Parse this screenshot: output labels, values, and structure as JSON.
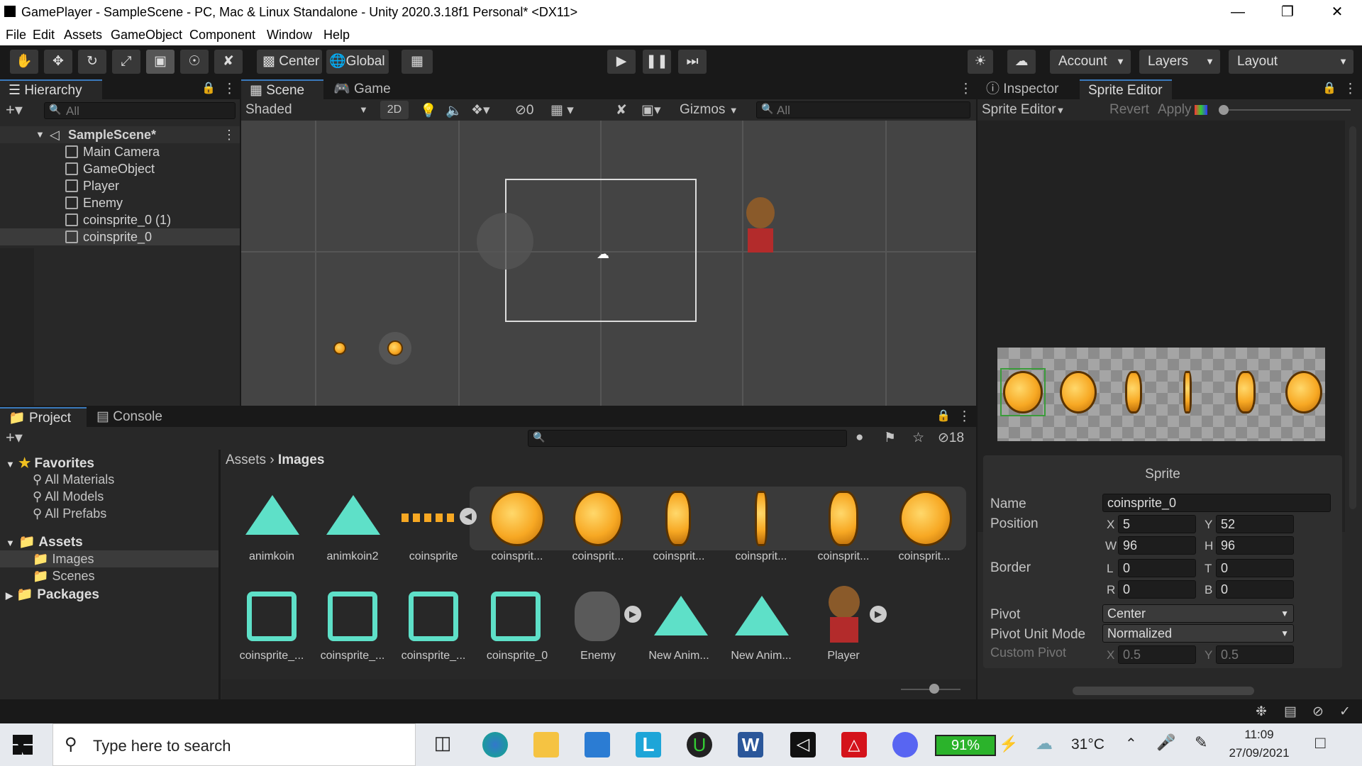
{
  "window": {
    "title": "GamePlayer - SampleScene - PC, Mac & Linux Standalone - Unity 2020.3.18f1 Personal* <DX11>"
  },
  "menu": [
    "File",
    "Edit",
    "Assets",
    "GameObject",
    "Component",
    "Window",
    "Help"
  ],
  "toolbar": {
    "pivot": "Center",
    "space": "Global",
    "account": "Account",
    "layers": "Layers",
    "layout": "Layout"
  },
  "hierarchy": {
    "tab": "Hierarchy",
    "search_placeholder": "All",
    "scene": "SampleScene*",
    "items": [
      "Main Camera",
      "GameObject",
      "Player",
      "Enemy",
      "coinsprite_0 (1)",
      "coinsprite_0"
    ]
  },
  "scene": {
    "tabs": [
      "Scene",
      "Game"
    ],
    "shading": "Shaded",
    "mode2d": "2D",
    "hidden_count": "0",
    "gizmos": "Gizmos",
    "search_placeholder": "All"
  },
  "project": {
    "tabs": [
      "Project",
      "Console"
    ],
    "hidden_count": "18",
    "favorites": "Favorites",
    "fav_items": [
      "All Materials",
      "All Models",
      "All Prefabs"
    ],
    "assets": "Assets",
    "asset_folders": [
      "Images",
      "Scenes"
    ],
    "packages": "Packages",
    "breadcrumb": [
      "Assets",
      "Images"
    ],
    "row1": [
      "animkoin",
      "animkoin2",
      "coinsprite",
      "coinsprit...",
      "coinsprit...",
      "coinsprit...",
      "coinsprit...",
      "coinsprit...",
      "coinsprit..."
    ],
    "row2": [
      "coinsprite_...",
      "coinsprite_...",
      "coinsprite_...",
      "coinsprite_0",
      "Enemy",
      "New Anim...",
      "New Anim...",
      "Player"
    ]
  },
  "inspector": {
    "tabs": [
      "Inspector",
      "Sprite Editor"
    ],
    "sprite_editor_dropdown": "Sprite Editor",
    "revert": "Revert",
    "apply": "Apply",
    "section": "Sprite",
    "name_label": "Name",
    "name_value": "coinsprite_0",
    "position_label": "Position",
    "x": "5",
    "y": "52",
    "w": "96",
    "h": "96",
    "border_label": "Border",
    "l": "0",
    "t": "0",
    "r": "0",
    "b": "0",
    "pivot_label": "Pivot",
    "pivot_value": "Center",
    "pivot_unit_label": "Pivot Unit Mode",
    "pivot_unit_value": "Normalized",
    "custom_pivot_label": "Custom Pivot",
    "cpx": "0.5",
    "cpy": "0.5"
  },
  "taskbar": {
    "search_placeholder": "Type here to search",
    "battery": "91%",
    "temperature": "31°C",
    "time": "11:09",
    "date": "27/09/2021"
  }
}
